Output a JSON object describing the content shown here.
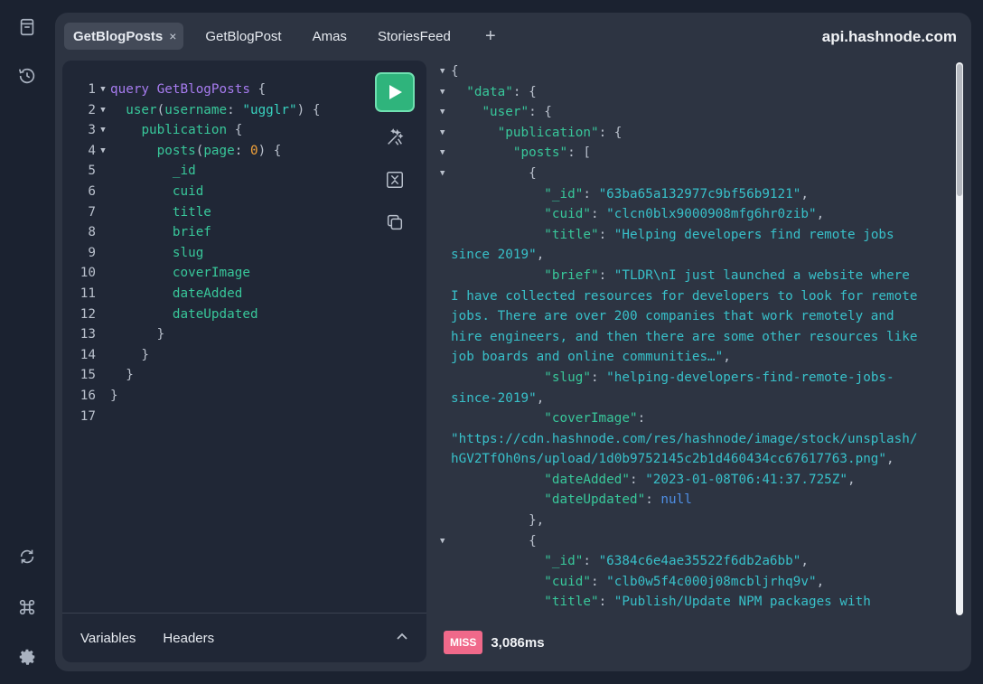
{
  "rail": {
    "top_icons": [
      "docs-icon",
      "history-icon"
    ],
    "bottom_icons": [
      "refresh-icon",
      "command-icon",
      "settings-icon"
    ]
  },
  "tabs": [
    {
      "label": "GetBlogPosts",
      "active": true
    },
    {
      "label": "GetBlogPost",
      "active": false
    },
    {
      "label": "Amas",
      "active": false
    },
    {
      "label": "StoriesFeed",
      "active": false
    }
  ],
  "tab_add": "+",
  "tab_close": "×",
  "host": "api.hashnode.com",
  "editor": {
    "lines": [
      {
        "n": "1",
        "fold": true,
        "parts": [
          [
            "kw",
            "query "
          ],
          [
            "fn",
            "GetBlogPosts"
          ],
          [
            "pun",
            " {"
          ]
        ]
      },
      {
        "n": "2",
        "fold": true,
        "parts": [
          [
            "pun",
            "  "
          ],
          [
            "fld",
            "user"
          ],
          [
            "pun",
            "("
          ],
          [
            "fld",
            "username"
          ],
          [
            "pun",
            ": "
          ],
          [
            "str",
            "\"ugglr\""
          ],
          [
            "pun",
            ") {"
          ]
        ]
      },
      {
        "n": "3",
        "fold": true,
        "parts": [
          [
            "pun",
            "    "
          ],
          [
            "fld",
            "publication"
          ],
          [
            "pun",
            " {"
          ]
        ]
      },
      {
        "n": "4",
        "fold": true,
        "parts": [
          [
            "pun",
            "      "
          ],
          [
            "fld",
            "posts"
          ],
          [
            "pun",
            "("
          ],
          [
            "fld",
            "page"
          ],
          [
            "pun",
            ": "
          ],
          [
            "num",
            "0"
          ],
          [
            "pun",
            ") {"
          ]
        ]
      },
      {
        "n": "5",
        "fold": false,
        "parts": [
          [
            "pun",
            "        "
          ],
          [
            "fld",
            "_id"
          ]
        ]
      },
      {
        "n": "6",
        "fold": false,
        "parts": [
          [
            "pun",
            "        "
          ],
          [
            "fld",
            "cuid"
          ]
        ]
      },
      {
        "n": "7",
        "fold": false,
        "parts": [
          [
            "pun",
            "        "
          ],
          [
            "fld",
            "title"
          ]
        ]
      },
      {
        "n": "8",
        "fold": false,
        "parts": [
          [
            "pun",
            "        "
          ],
          [
            "fld",
            "brief"
          ]
        ]
      },
      {
        "n": "9",
        "fold": false,
        "parts": [
          [
            "pun",
            "        "
          ],
          [
            "fld",
            "slug"
          ]
        ]
      },
      {
        "n": "10",
        "fold": false,
        "parts": [
          [
            "pun",
            "        "
          ],
          [
            "fld",
            "coverImage"
          ]
        ]
      },
      {
        "n": "11",
        "fold": false,
        "parts": [
          [
            "pun",
            "        "
          ],
          [
            "fld",
            "dateAdded"
          ]
        ]
      },
      {
        "n": "12",
        "fold": false,
        "parts": [
          [
            "pun",
            "        "
          ],
          [
            "fld",
            "dateUpdated"
          ]
        ]
      },
      {
        "n": "13",
        "fold": false,
        "parts": [
          [
            "pun",
            "      }"
          ]
        ]
      },
      {
        "n": "14",
        "fold": false,
        "parts": [
          [
            "pun",
            "    }"
          ]
        ]
      },
      {
        "n": "15",
        "fold": false,
        "parts": [
          [
            "pun",
            "  }"
          ]
        ]
      },
      {
        "n": "16",
        "fold": false,
        "parts": [
          [
            "pun",
            "}"
          ]
        ]
      },
      {
        "n": "17",
        "fold": false,
        "parts": []
      }
    ],
    "bottom_tabs": [
      "Variables",
      "Headers"
    ]
  },
  "response": {
    "lines": [
      {
        "fold": true,
        "parts": [
          [
            "pun",
            "{"
          ]
        ]
      },
      {
        "fold": true,
        "parts": [
          [
            "pun",
            "  "
          ],
          [
            "key",
            "\"data\""
          ],
          [
            "pun",
            ": {"
          ]
        ]
      },
      {
        "fold": true,
        "parts": [
          [
            "pun",
            "    "
          ],
          [
            "key",
            "\"user\""
          ],
          [
            "pun",
            ": {"
          ]
        ]
      },
      {
        "fold": true,
        "parts": [
          [
            "pun",
            "      "
          ],
          [
            "key",
            "\"publication\""
          ],
          [
            "pun",
            ": {"
          ]
        ]
      },
      {
        "fold": true,
        "parts": [
          [
            "pun",
            "        "
          ],
          [
            "key",
            "\"posts\""
          ],
          [
            "pun",
            ": ["
          ]
        ]
      },
      {
        "fold": true,
        "parts": [
          [
            "pun",
            "          {"
          ]
        ]
      },
      {
        "fold": false,
        "parts": [
          [
            "pun",
            "            "
          ],
          [
            "key",
            "\"_id\""
          ],
          [
            "pun",
            ": "
          ],
          [
            "sval",
            "\"63ba65a132977c9bf56b9121\""
          ],
          [
            "pun",
            ","
          ]
        ]
      },
      {
        "fold": false,
        "parts": [
          [
            "pun",
            "            "
          ],
          [
            "key",
            "\"cuid\""
          ],
          [
            "pun",
            ": "
          ],
          [
            "sval",
            "\"clcn0blx9000908mfg6hr0zib\""
          ],
          [
            "pun",
            ","
          ]
        ]
      },
      {
        "fold": false,
        "parts": [
          [
            "pun",
            "            "
          ],
          [
            "key",
            "\"title\""
          ],
          [
            "pun",
            ": "
          ],
          [
            "sval",
            "\"Helping developers find remote jobs"
          ]
        ]
      },
      {
        "fold": false,
        "parts": [
          [
            "sval",
            "since 2019\""
          ],
          [
            "pun",
            ","
          ]
        ]
      },
      {
        "fold": false,
        "parts": [
          [
            "pun",
            "            "
          ],
          [
            "key",
            "\"brief\""
          ],
          [
            "pun",
            ": "
          ],
          [
            "sval",
            "\"TLDR\\nI just launched a website where"
          ]
        ]
      },
      {
        "fold": false,
        "parts": [
          [
            "sval",
            "I have collected resources for developers to look for remote"
          ]
        ]
      },
      {
        "fold": false,
        "parts": [
          [
            "sval",
            "jobs. There are over 200 companies that work remotely and"
          ]
        ]
      },
      {
        "fold": false,
        "parts": [
          [
            "sval",
            "hire engineers, and then there are some other resources like"
          ]
        ]
      },
      {
        "fold": false,
        "parts": [
          [
            "sval",
            "job boards and online communities…\""
          ],
          [
            "pun",
            ","
          ]
        ]
      },
      {
        "fold": false,
        "parts": [
          [
            "pun",
            "            "
          ],
          [
            "key",
            "\"slug\""
          ],
          [
            "pun",
            ": "
          ],
          [
            "sval",
            "\"helping-developers-find-remote-jobs-"
          ]
        ]
      },
      {
        "fold": false,
        "parts": [
          [
            "sval",
            "since-2019\""
          ],
          [
            "pun",
            ","
          ]
        ]
      },
      {
        "fold": false,
        "parts": [
          [
            "pun",
            "            "
          ],
          [
            "key",
            "\"coverImage\""
          ],
          [
            "pun",
            ":"
          ]
        ]
      },
      {
        "fold": false,
        "parts": [
          [
            "sval",
            "\"https://cdn.hashnode.com/res/hashnode/image/stock/unsplash/"
          ]
        ]
      },
      {
        "fold": false,
        "parts": [
          [
            "sval",
            "hGV2TfOh0ns/upload/1d0b9752145c2b1d460434cc67617763.png\""
          ],
          [
            "pun",
            ","
          ]
        ]
      },
      {
        "fold": false,
        "parts": [
          [
            "pun",
            "            "
          ],
          [
            "key",
            "\"dateAdded\""
          ],
          [
            "pun",
            ": "
          ],
          [
            "sval",
            "\"2023-01-08T06:41:37.725Z\""
          ],
          [
            "pun",
            ","
          ]
        ]
      },
      {
        "fold": false,
        "parts": [
          [
            "pun",
            "            "
          ],
          [
            "key",
            "\"dateUpdated\""
          ],
          [
            "pun",
            ": "
          ],
          [
            "nul",
            "null"
          ]
        ]
      },
      {
        "fold": false,
        "parts": [
          [
            "pun",
            "          },"
          ]
        ]
      },
      {
        "fold": true,
        "parts": [
          [
            "pun",
            "          {"
          ]
        ]
      },
      {
        "fold": false,
        "parts": [
          [
            "pun",
            "            "
          ],
          [
            "key",
            "\"_id\""
          ],
          [
            "pun",
            ": "
          ],
          [
            "sval",
            "\"6384c6e4ae35522f6db2a6bb\""
          ],
          [
            "pun",
            ","
          ]
        ]
      },
      {
        "fold": false,
        "parts": [
          [
            "pun",
            "            "
          ],
          [
            "key",
            "\"cuid\""
          ],
          [
            "pun",
            ": "
          ],
          [
            "sval",
            "\"clb0w5f4c000j08mcbljrhq9v\""
          ],
          [
            "pun",
            ","
          ]
        ]
      },
      {
        "fold": false,
        "parts": [
          [
            "pun",
            "            "
          ],
          [
            "key",
            "\"title\""
          ],
          [
            "pun",
            ": "
          ],
          [
            "sval",
            "\"Publish/Update NPM packages with"
          ]
        ]
      }
    ]
  },
  "status": {
    "cache": "MISS",
    "time": "3,086ms"
  },
  "colors": {
    "accent": "#2fb47c",
    "miss": "#f0698a",
    "background": "#1b2230",
    "panel": "#2d3442"
  }
}
